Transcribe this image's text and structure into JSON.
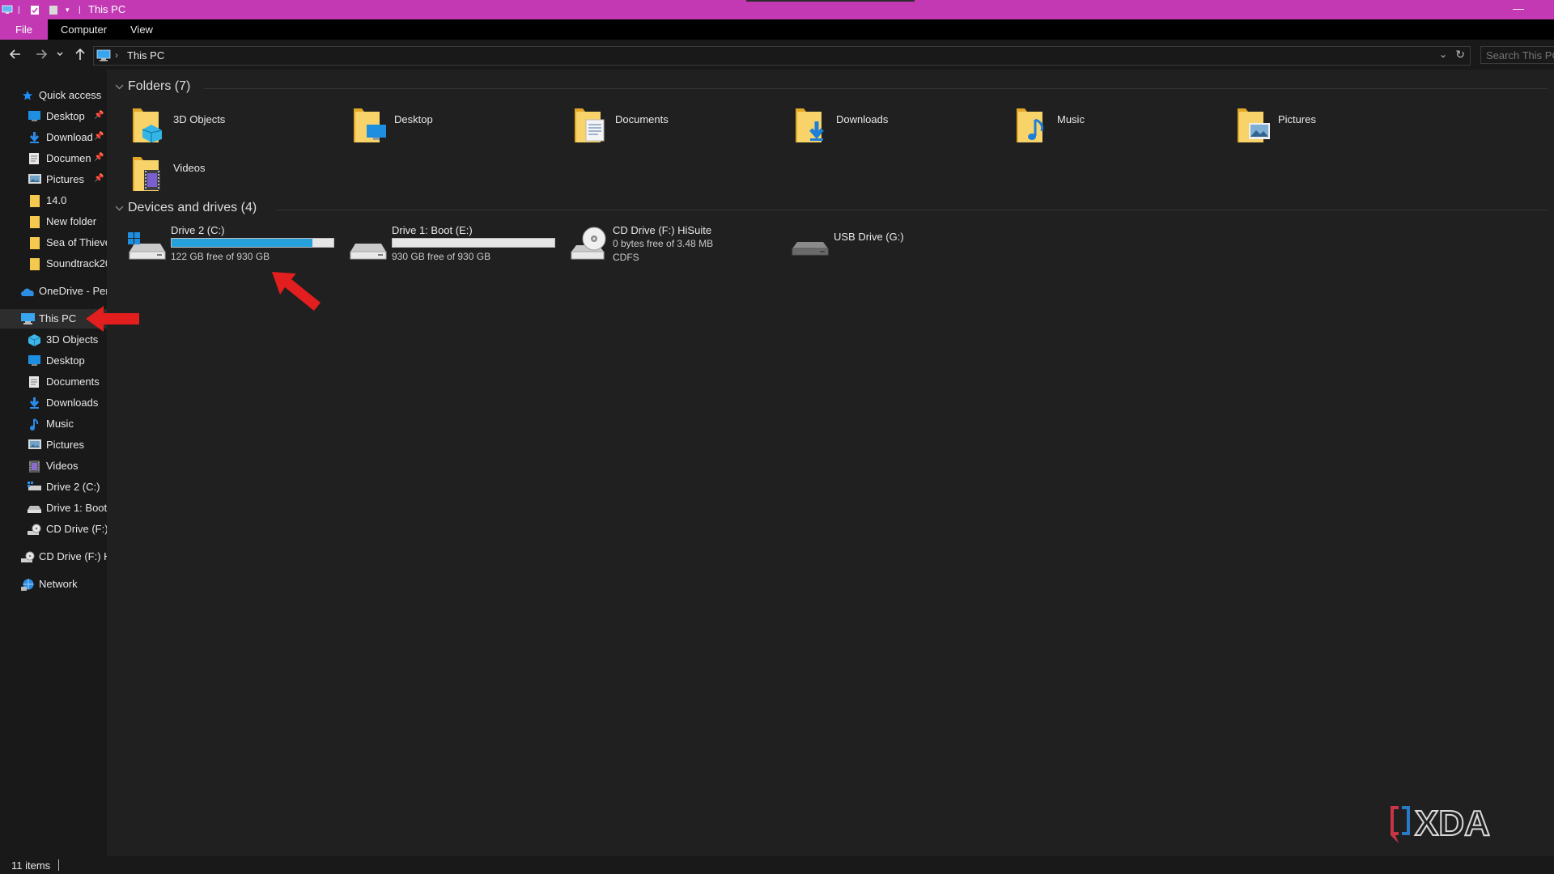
{
  "window": {
    "title": "This PC",
    "minimize_label": "—"
  },
  "ribbon": {
    "tabs": [
      "File",
      "Computer",
      "View"
    ]
  },
  "address": {
    "breadcrumb": "This PC",
    "separator": "›"
  },
  "search": {
    "placeholder": "Search This PC"
  },
  "sidebar": {
    "items": [
      {
        "label": "Quick access",
        "icon": "star-icon",
        "level": 0
      },
      {
        "label": "Desktop",
        "icon": "desktop-folder-icon",
        "level": 1,
        "pinned": true
      },
      {
        "label": "Download",
        "icon": "downloads-arrow-icon",
        "level": 1,
        "pinned": true
      },
      {
        "label": "Documen",
        "icon": "documents-icon",
        "level": 1,
        "pinned": true
      },
      {
        "label": "Pictures",
        "icon": "pictures-icon",
        "level": 1,
        "pinned": true
      },
      {
        "label": "14.0",
        "icon": "folder-icon",
        "level": 1
      },
      {
        "label": "New folder",
        "icon": "folder-icon",
        "level": 1
      },
      {
        "label": "Sea of Thieve",
        "icon": "folder-icon",
        "level": 1
      },
      {
        "label": "Soundtrack20",
        "icon": "folder-icon",
        "level": 1
      },
      {
        "label": "OneDrive - Per",
        "icon": "cloud-icon",
        "level": 0
      },
      {
        "label": "This PC",
        "icon": "computer-icon",
        "level": 0,
        "selected": true
      },
      {
        "label": "3D Objects",
        "icon": "cube-icon",
        "level": 1
      },
      {
        "label": "Desktop",
        "icon": "desktop-folder-icon",
        "level": 1
      },
      {
        "label": "Documents",
        "icon": "documents-icon",
        "level": 1
      },
      {
        "label": "Downloads",
        "icon": "downloads-arrow-icon",
        "level": 1
      },
      {
        "label": "Music",
        "icon": "music-note-icon",
        "level": 1
      },
      {
        "label": "Pictures",
        "icon": "pictures-icon",
        "level": 1
      },
      {
        "label": "Videos",
        "icon": "videos-icon",
        "level": 1
      },
      {
        "label": "Drive 2 (C:)",
        "icon": "windows-drive-icon",
        "level": 1
      },
      {
        "label": "Drive 1: Boot",
        "icon": "hard-drive-icon",
        "level": 1
      },
      {
        "label": "CD Drive (F:)",
        "icon": "cd-drive-icon",
        "level": 1
      },
      {
        "label": "CD Drive (F:) H",
        "icon": "cd-drive-icon",
        "level": 0
      },
      {
        "label": "Network",
        "icon": "network-icon",
        "level": 0
      }
    ]
  },
  "content": {
    "folders_header": "Folders (7)",
    "folders": [
      {
        "name": "3D Objects",
        "icon": "folder-3d-objects-icon"
      },
      {
        "name": "Desktop",
        "icon": "folder-desktop-icon"
      },
      {
        "name": "Documents",
        "icon": "folder-documents-icon"
      },
      {
        "name": "Downloads",
        "icon": "folder-downloads-icon"
      },
      {
        "name": "Music",
        "icon": "folder-music-icon"
      },
      {
        "name": "Pictures",
        "icon": "folder-pictures-icon"
      },
      {
        "name": "Videos",
        "icon": "folder-videos-icon"
      }
    ],
    "drives_header": "Devices and drives (4)",
    "drives": [
      {
        "name": "Drive 2 (C:)",
        "free": "122 GB free of 930 GB",
        "used_fraction": 0.87,
        "icon": "windows-drive-icon"
      },
      {
        "name": "Drive 1: Boot (E:)",
        "free": "930 GB free of 930 GB",
        "used_fraction": 0.0,
        "icon": "hard-drive-icon"
      },
      {
        "name": "CD Drive (F:) HiSuite",
        "free": "0 bytes free of 3.48 MB",
        "filesystem": "CDFS",
        "icon": "cd-drive-icon"
      },
      {
        "name": "USB Drive (G:)",
        "icon": "usb-drive-icon"
      }
    ]
  },
  "status": {
    "item_count": "11 items"
  },
  "colors": {
    "accent": "#c239b3",
    "usage_bar": "#26a0da",
    "annotation_arrow": "#e31e1e",
    "background": "#202020"
  },
  "watermark": {
    "text": "XDA"
  }
}
